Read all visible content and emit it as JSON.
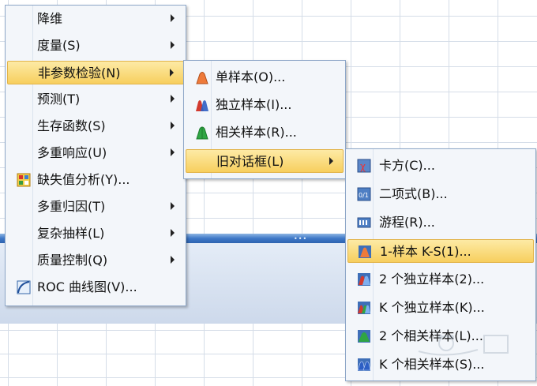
{
  "colors": {
    "highlight": "#f7cf5e",
    "menu_bg": "#f3f6fa",
    "splitter": "#3e78c8"
  },
  "splitter": {
    "grip": "•••"
  },
  "analyze_menu": {
    "items": [
      {
        "label": "降维",
        "submenu": true
      },
      {
        "label": "度量(S)",
        "submenu": true
      },
      {
        "label": "非参数检验(N)",
        "submenu": true,
        "highlighted": true
      },
      {
        "label": "预测(T)",
        "submenu": true
      },
      {
        "label": "生存函数(S)",
        "submenu": true
      },
      {
        "label": "多重响应(U)",
        "submenu": true
      },
      {
        "label": "缺失值分析(Y)...",
        "icon": "missing-value-icon"
      },
      {
        "label": "多重归因(T)",
        "submenu": true
      },
      {
        "label": "复杂抽样(L)",
        "submenu": true
      },
      {
        "label": "质量控制(Q)",
        "submenu": true
      },
      {
        "label": "ROC 曲线图(V)...",
        "icon": "roc-curve-icon"
      }
    ]
  },
  "nonparam_menu": {
    "items": [
      {
        "label": "单样本(O)...",
        "icon": "one-sample-icon"
      },
      {
        "label": "独立样本(I)...",
        "icon": "independent-samples-icon"
      },
      {
        "label": "相关样本(R)...",
        "icon": "related-samples-icon"
      },
      {
        "label": "旧对话框(L)",
        "submenu": true,
        "highlighted": true
      }
    ]
  },
  "legacy_menu": {
    "items": [
      {
        "label": "卡方(C)...",
        "icon": "chi-square-icon"
      },
      {
        "label": "二项式(B)...",
        "icon": "binomial-icon"
      },
      {
        "label": "游程(R)...",
        "icon": "runs-icon"
      },
      {
        "label": "1-样本 K-S(1)...",
        "icon": "ks-one-sample-icon",
        "highlighted": true
      },
      {
        "label": "2 个独立样本(2)...",
        "icon": "two-independent-icon"
      },
      {
        "label": "K 个独立样本(K)...",
        "icon": "k-independent-icon"
      },
      {
        "label": "2 个相关样本(L)...",
        "icon": "two-related-icon"
      },
      {
        "label": "K 个相关样本(S)...",
        "icon": "k-related-icon"
      }
    ]
  }
}
